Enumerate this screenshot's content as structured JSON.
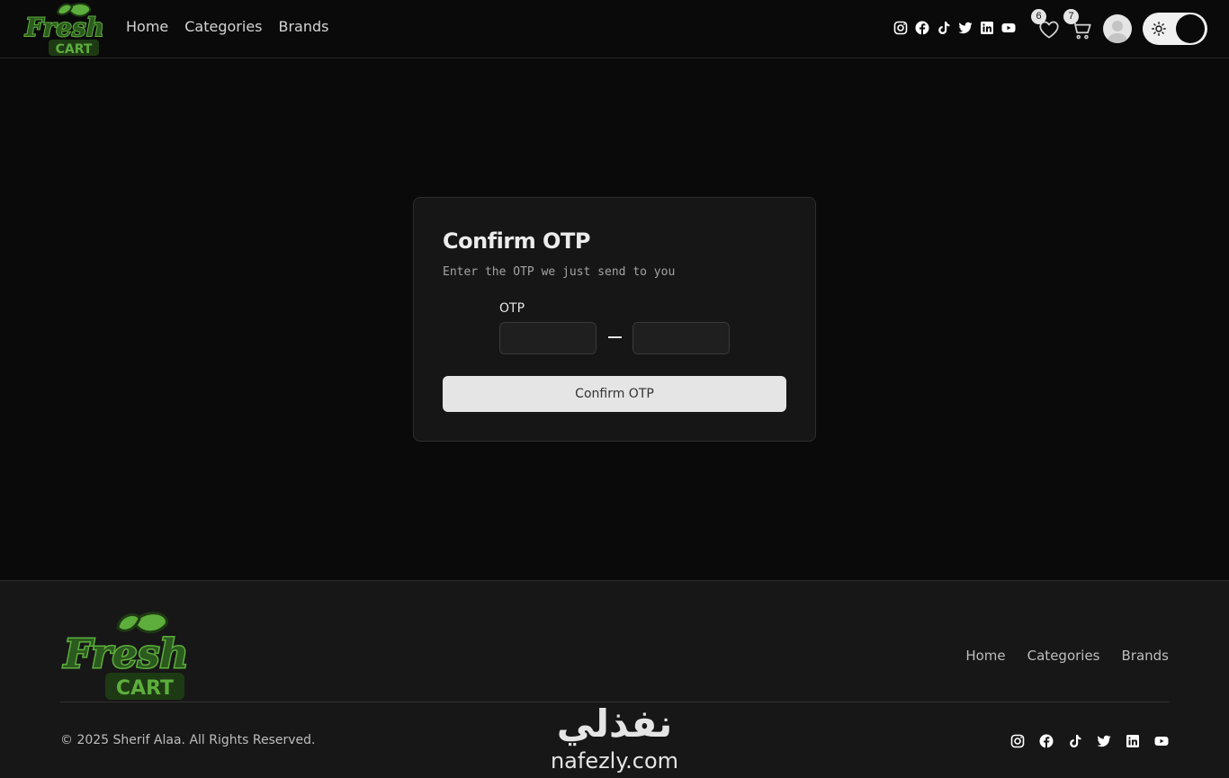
{
  "brand": {
    "logo_word1": "Fresh",
    "logo_word2": "CART",
    "colors": {
      "leaf": "#5dae3c",
      "text_dark": "#2b5a1e",
      "outline": "#1e3a14"
    }
  },
  "nav": {
    "links": [
      "Home",
      "Categories",
      "Brands"
    ],
    "social_icons": [
      "instagram-icon",
      "facebook-icon",
      "tiktok-icon",
      "twitter-icon",
      "linkedin-icon",
      "youtube-icon"
    ],
    "wishlist_count": "6",
    "cart_count": "7",
    "theme_toggle_icon": "sun-icon"
  },
  "otp_card": {
    "title": "Confirm OTP",
    "subtitle": "Enter the OTP we just send to you",
    "label": "OTP",
    "button": "Confirm OTP"
  },
  "footer": {
    "links": [
      "Home",
      "Categories",
      "Brands"
    ],
    "copyright": "© 2025 Sherif Alaa. All Rights Reserved.",
    "social_icons": [
      "instagram-icon",
      "facebook-icon",
      "tiktok-icon",
      "twitter-icon",
      "linkedin-icon",
      "youtube-icon"
    ]
  },
  "watermark": {
    "arabic": "نفذلي",
    "latin": "nafezly.com"
  },
  "colors": {
    "page_bg": "#0a0a0a",
    "card_bg": "#161616",
    "footer_bg": "#171717",
    "button_bg": "#e5e5e5"
  }
}
